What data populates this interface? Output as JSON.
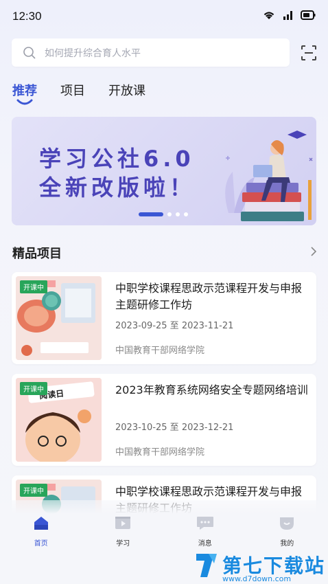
{
  "status": {
    "time": "12:30"
  },
  "search": {
    "placeholder": "如何提升综合育人水平"
  },
  "tabs": [
    {
      "label": "推荐",
      "active": true
    },
    {
      "label": "项目",
      "active": false
    },
    {
      "label": "开放课",
      "active": false
    }
  ],
  "banner": {
    "line1": "学习公社6.0",
    "line2": "全新改版啦！",
    "slide_count": 4,
    "active_slide": 1
  },
  "section": {
    "title": "精品项目"
  },
  "cards": [
    {
      "badge": "开课中",
      "title": "中职学校课程思政示范课程开发与申报主题研修工作坊",
      "date": "2023-09-25 至 2023-11-21",
      "org": "中国教育干部网络学院"
    },
    {
      "badge": "开课中",
      "title": "2023年教育系统网络安全专题网络培训",
      "date": "2023-10-25 至 2023-12-21",
      "org": "中国教育干部网络学院"
    },
    {
      "badge": "开课中",
      "title": "中职学校课程思政示范课程开发与申报主题研修工作坊"
    }
  ],
  "nav": [
    {
      "label": "首页",
      "icon": "home-icon",
      "active": true
    },
    {
      "label": "学习",
      "icon": "play-icon",
      "active": false
    },
    {
      "label": "消息",
      "icon": "message-icon",
      "active": false
    },
    {
      "label": "我的",
      "icon": "profile-icon",
      "active": false
    }
  ],
  "watermark": {
    "text": "第七下载站",
    "url_text": "www.d7down.com"
  },
  "colors": {
    "accent": "#3a56d4",
    "badge": "#28a55a"
  }
}
